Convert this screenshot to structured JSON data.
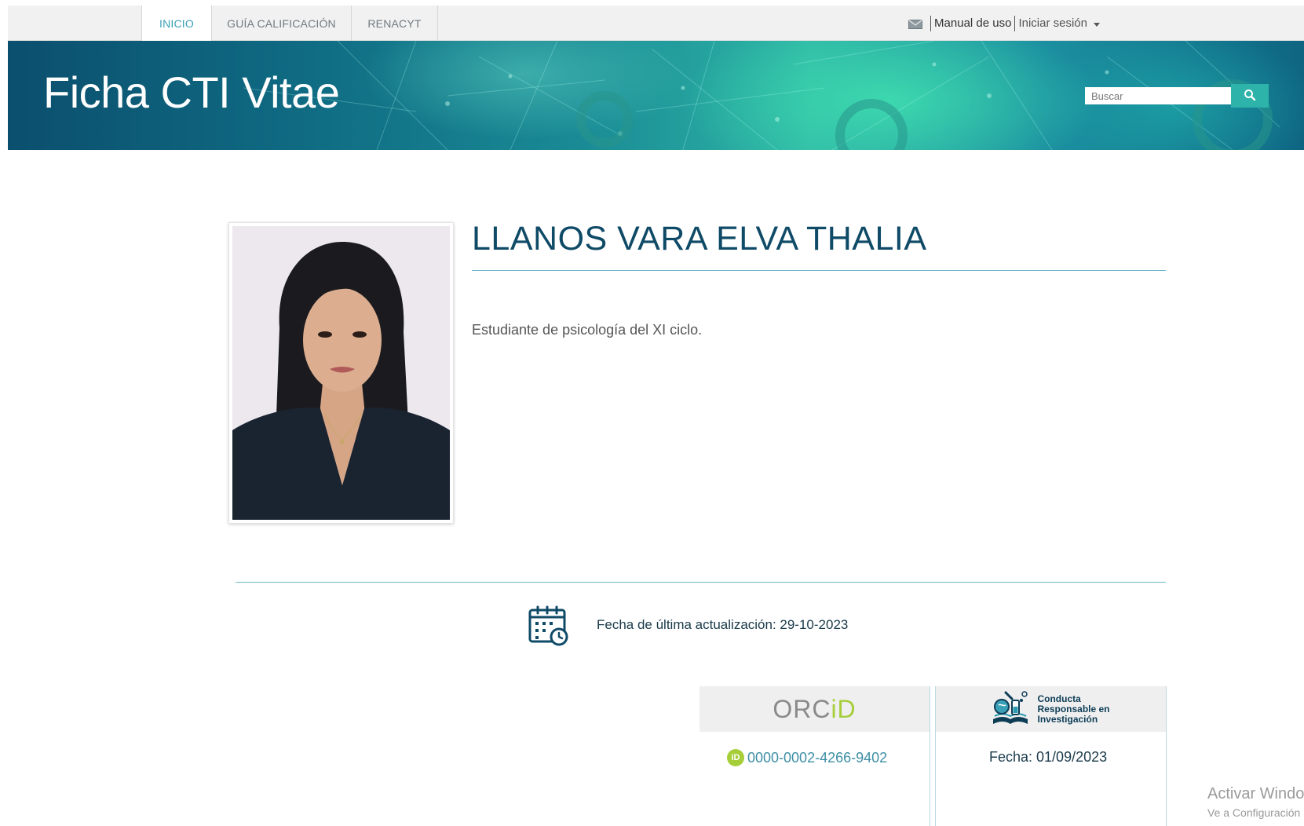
{
  "nav": {
    "tabs": [
      {
        "label": "INICIO",
        "active": true
      },
      {
        "label": "GUÍA CALIFICACIÓN",
        "active": false
      },
      {
        "label": "RENACYT",
        "active": false
      }
    ],
    "manual_label": "Manual de uso",
    "login_label": "Iniciar sesión"
  },
  "header": {
    "title": "Ficha CTI Vitae",
    "search_placeholder": "Buscar"
  },
  "profile": {
    "name": "LLANOS VARA ELVA THALIA",
    "description": "Estudiante de psicología del XI ciclo."
  },
  "update": {
    "label": "Fecha de última actualización: 29-10-2023"
  },
  "orcid": {
    "logo_text": "ORC",
    "logo_id": "iD",
    "badge_text": "iD",
    "id": "0000-0002-4266-9402"
  },
  "cri": {
    "line1": "Conducta",
    "line2": "Responsable en",
    "line3": "Investigación",
    "date": "Fecha:  01/09/2023"
  },
  "watermark": {
    "line1": "Activar Windows",
    "line2": "Ve a Configuración para activar Windows."
  },
  "colors": {
    "accent": "#3aa0b8",
    "name": "#0f4a67",
    "orcid_green": "#a6ce39"
  }
}
